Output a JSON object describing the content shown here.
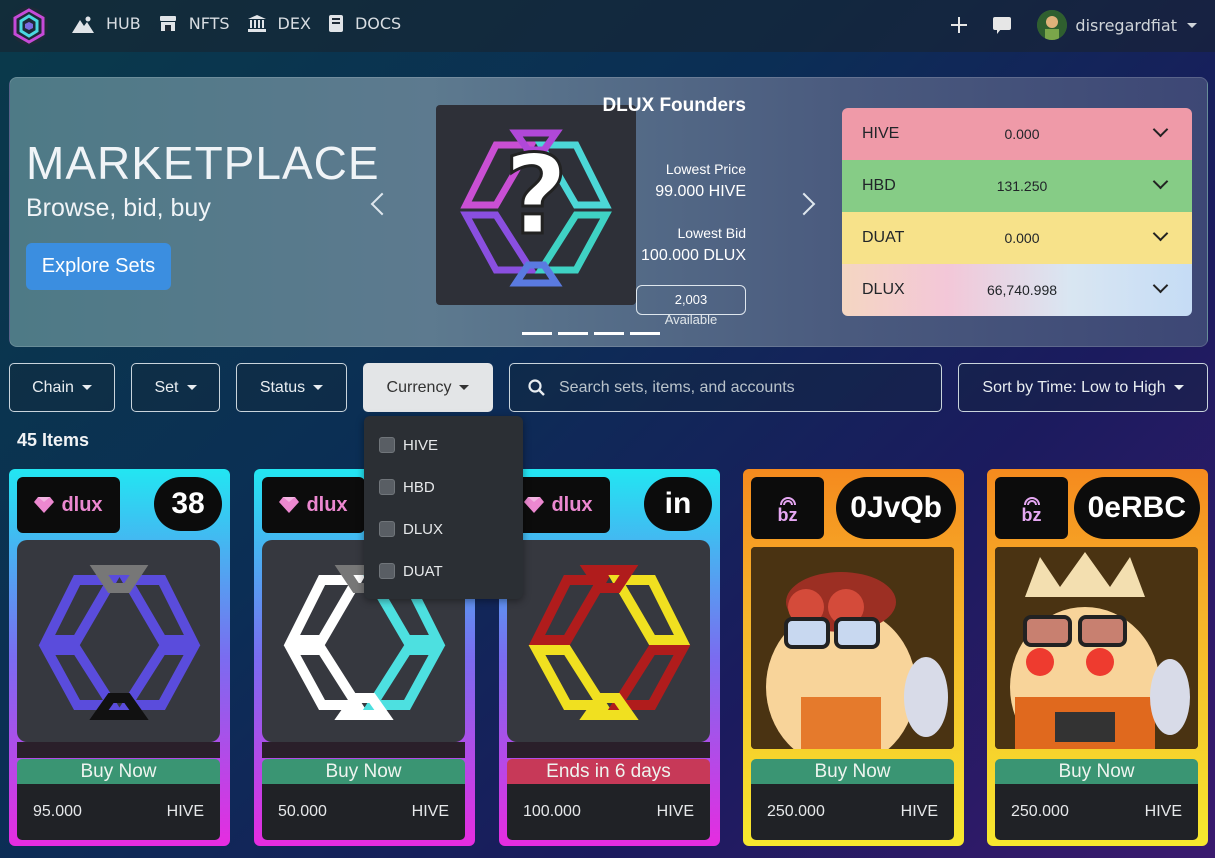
{
  "nav": {
    "links": [
      {
        "label": "HUB",
        "icon": "mountain-icon"
      },
      {
        "label": "NFTS",
        "icon": "store-icon"
      },
      {
        "label": "DEX",
        "icon": "bank-icon"
      },
      {
        "label": "DOCS",
        "icon": "book-icon"
      }
    ],
    "username": "disregardfiat"
  },
  "hero": {
    "title": "MARKETPLACE",
    "subtitle": "Browse, bid, buy",
    "cta": "Explore Sets",
    "featured": {
      "title": "DLUX Founders",
      "lowest_price_label": "Lowest Price",
      "lowest_price": "99.000 HIVE",
      "lowest_bid_label": "Lowest Bid",
      "lowest_bid": "100.000 DLUX",
      "available_count": "2,003",
      "available_label": "Available"
    }
  },
  "balances": [
    {
      "name": "HIVE",
      "value": "0.000",
      "color": "#ef9aa8"
    },
    {
      "name": "HBD",
      "value": "131.250",
      "color": "#86cc86"
    },
    {
      "name": "DUAT",
      "value": "0.000",
      "color": "#f7e28a"
    },
    {
      "name": "DLUX",
      "value": "66,740.998",
      "color": "gradient"
    }
  ],
  "filters": {
    "chain": "Chain",
    "set": "Set",
    "status": "Status",
    "currency": "Currency",
    "search_placeholder": "Search sets, items, and accounts",
    "sort": "Sort by Time: Low to High"
  },
  "items_count": "45 Items",
  "currency_options": [
    "HIVE",
    "HBD",
    "DLUX",
    "DUAT"
  ],
  "cards": [
    {
      "tag": "dlux",
      "number": "38",
      "cta": "Buy Now",
      "cta_color": "#3a9573",
      "price": "95.000",
      "currency": "HIVE",
      "frame": "cyan-magenta"
    },
    {
      "tag": "dlux",
      "number": "",
      "cta": "Buy Now",
      "cta_color": "#3a9573",
      "price": "50.000",
      "currency": "HIVE",
      "frame": "cyan-magenta"
    },
    {
      "tag": "dlux",
      "number": "in",
      "cta": "Ends in 6 days",
      "cta_color": "#c73958",
      "price": "100.000",
      "currency": "HIVE",
      "frame": "cyan-magenta"
    },
    {
      "tag": "bz",
      "number": "0JvQb",
      "cta": "Buy Now",
      "cta_color": "#3a9573",
      "price": "250.000",
      "currency": "HIVE",
      "frame": "orange-yellow"
    },
    {
      "tag": "bz",
      "number": "0eRBC",
      "cta": "Buy Now",
      "cta_color": "#3a9573",
      "price": "250.000",
      "currency": "HIVE",
      "frame": "orange-yellow"
    }
  ]
}
